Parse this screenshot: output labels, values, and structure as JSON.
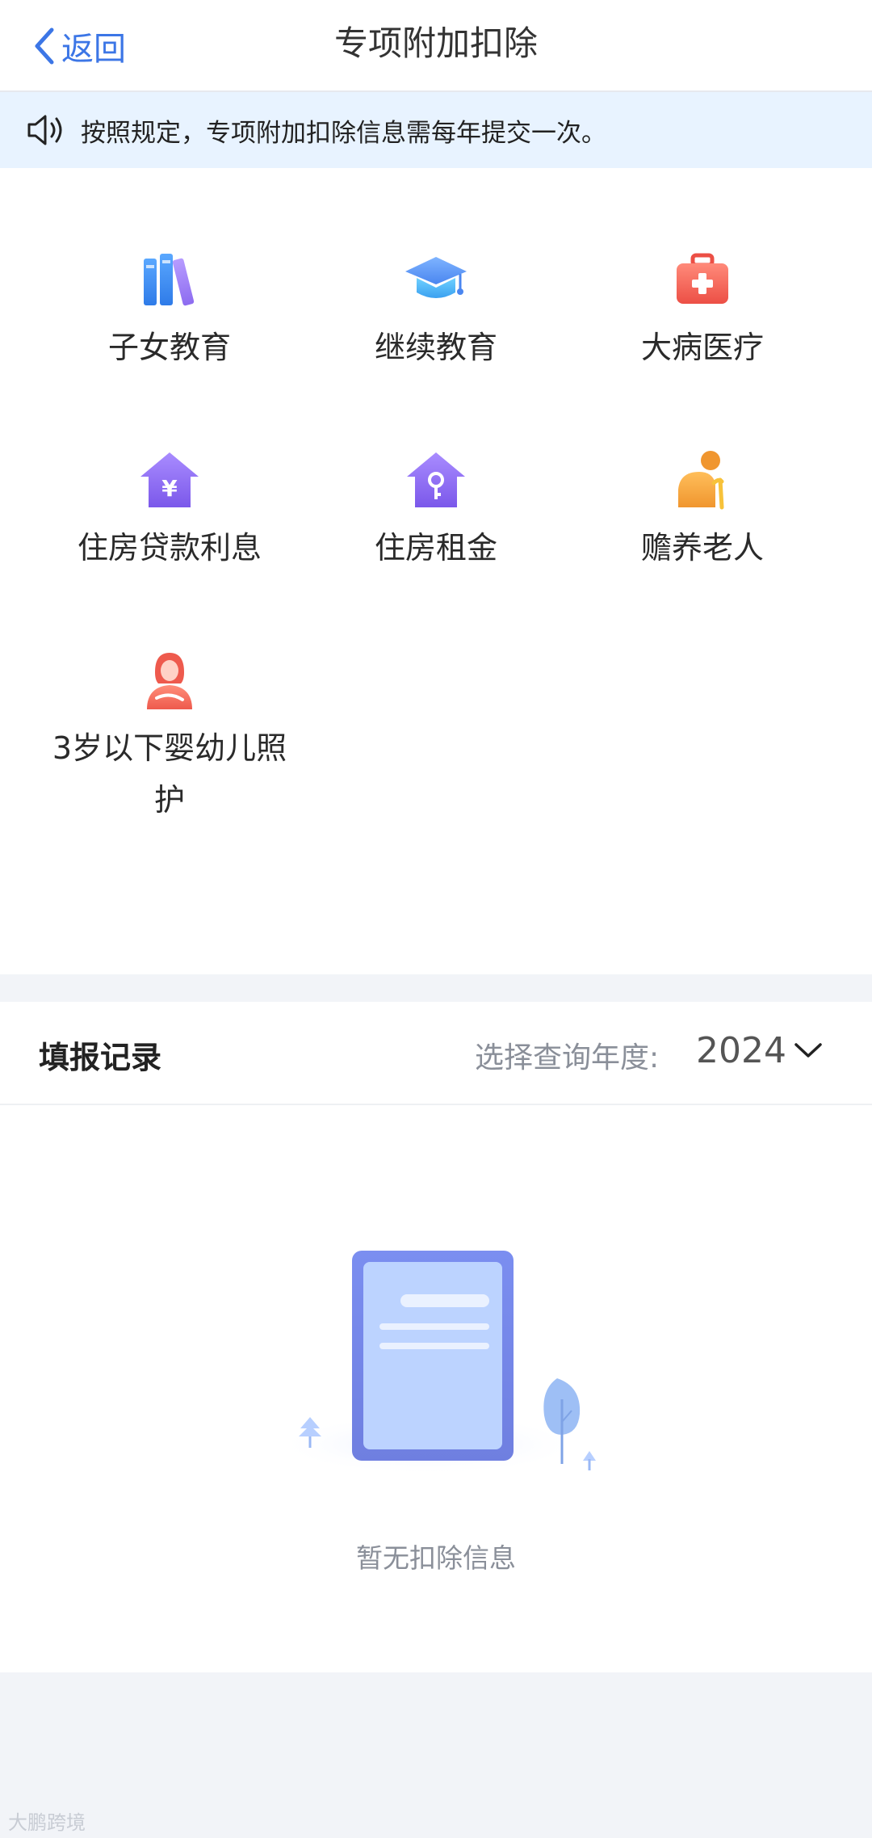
{
  "header": {
    "back_label": "返回",
    "title": "专项附加扣除"
  },
  "notice": {
    "text": "按照规定，专项附加扣除信息需每年提交一次。"
  },
  "categories": [
    {
      "label": "子女教育",
      "icon": "books-icon"
    },
    {
      "label": "继续教育",
      "icon": "graduation-cap-icon"
    },
    {
      "label": "大病医疗",
      "icon": "medical-kit-icon"
    },
    {
      "label": "住房贷款利息",
      "icon": "house-yen-icon"
    },
    {
      "label": "住房租金",
      "icon": "house-key-icon"
    },
    {
      "label": "赡养老人",
      "icon": "elderly-person-icon"
    },
    {
      "label": "3岁以下婴幼儿照\n护",
      "icon": "mother-baby-icon"
    }
  ],
  "records": {
    "title": "填报记录",
    "year_label": "选择查询年度:",
    "year_value": "2024",
    "empty_text": "暂无扣除信息"
  },
  "watermark": "大鹏跨境",
  "colors": {
    "accent": "#3c76e6",
    "notice_bg": "#e8f3ff",
    "page_bg": "#f2f4f8"
  }
}
